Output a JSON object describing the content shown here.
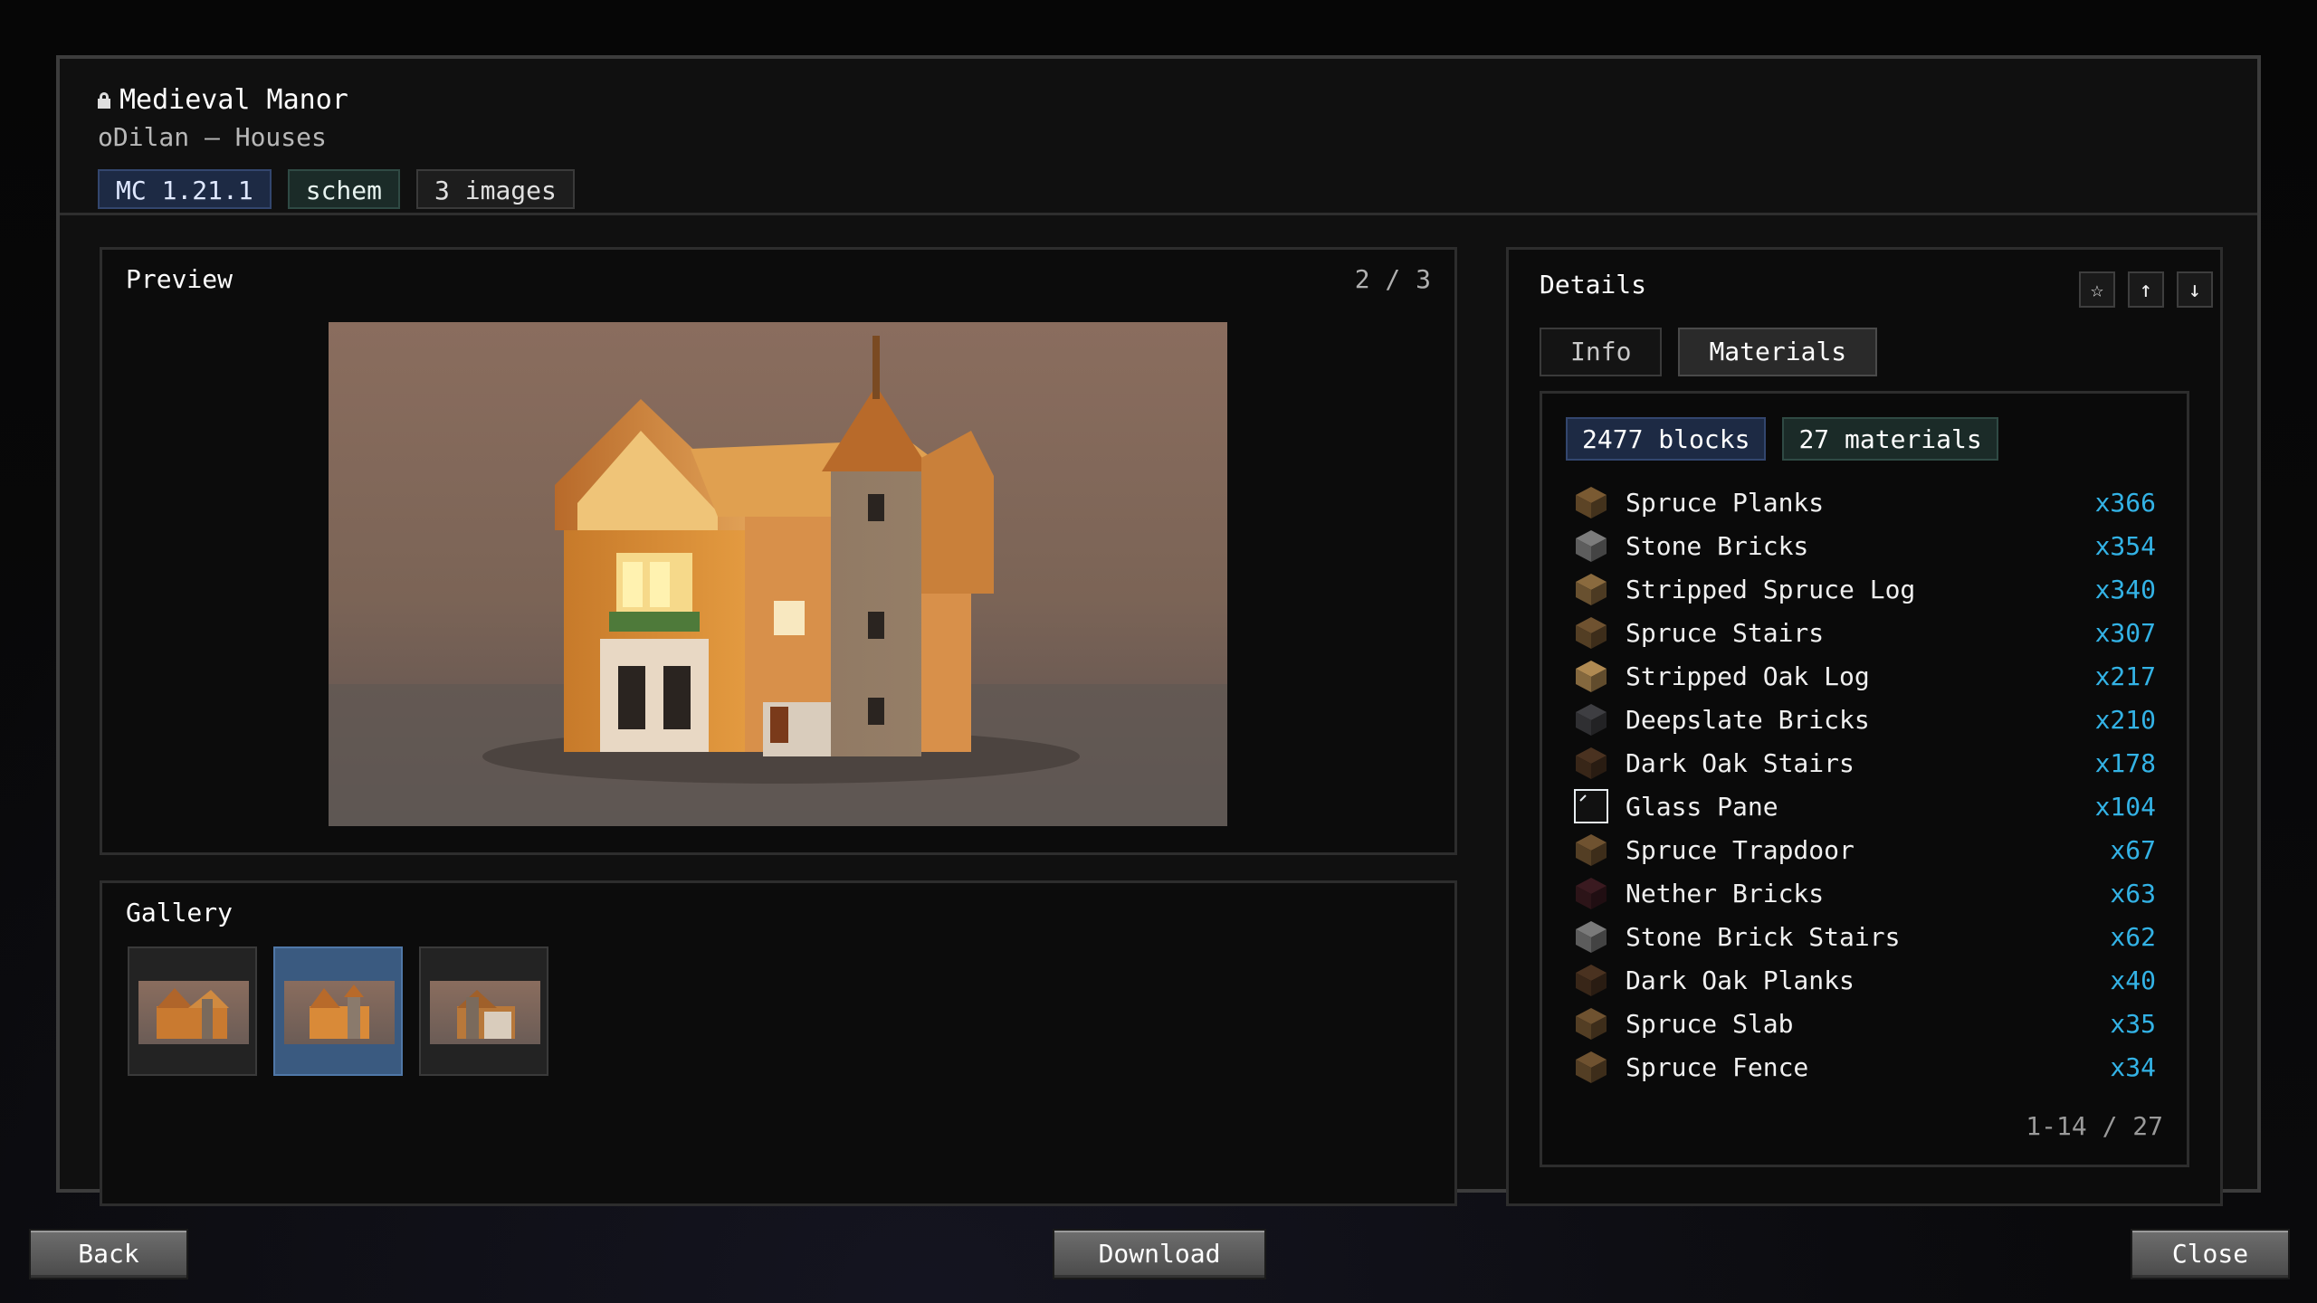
{
  "header": {
    "title": "Medieval Manor",
    "subtitle": "oDilan  –  Houses",
    "tags": [
      "MC 1.21.1",
      "schem",
      "3 images"
    ]
  },
  "preview": {
    "title": "Preview",
    "counter": "2 / 3"
  },
  "gallery": {
    "title": "Gallery",
    "selected_index": 1,
    "thumb_count": 3
  },
  "details": {
    "title": "Details",
    "icons": [
      "star-icon",
      "upload-icon",
      "download-icon"
    ],
    "tabs": [
      "Info",
      "Materials"
    ],
    "active_tab": "Materials",
    "stats": {
      "blocks": "2477 blocks",
      "materials": "27 materials"
    },
    "materials": [
      {
        "name": "Spruce Planks",
        "count": "x366",
        "icon": "spruce-planks-icon",
        "color": "#7a5a32"
      },
      {
        "name": "Stone Bricks",
        "count": "x354",
        "icon": "stone-bricks-icon",
        "color": "#7c7c7c"
      },
      {
        "name": "Stripped Spruce Log",
        "count": "x340",
        "icon": "stripped-spruce-log-icon",
        "color": "#8a6a3e"
      },
      {
        "name": "Spruce Stairs",
        "count": "x307",
        "icon": "spruce-stairs-icon",
        "color": "#6f5230"
      },
      {
        "name": "Stripped Oak Log",
        "count": "x217",
        "icon": "stripped-oak-log-icon",
        "color": "#b08a52"
      },
      {
        "name": "Deepslate Bricks",
        "count": "x210",
        "icon": "deepslate-bricks-icon",
        "color": "#3e3e42"
      },
      {
        "name": "Dark Oak Stairs",
        "count": "x178",
        "icon": "dark-oak-stairs-icon",
        "color": "#4a3220"
      },
      {
        "name": "Glass Pane",
        "count": "x104",
        "icon": "glass-pane-icon",
        "color": "#d8e8f0"
      },
      {
        "name": "Spruce Trapdoor",
        "count": "x67",
        "icon": "spruce-trapdoor-icon",
        "color": "#6f5230"
      },
      {
        "name": "Nether Bricks",
        "count": "x63",
        "icon": "nether-bricks-icon",
        "color": "#3a1a20"
      },
      {
        "name": "Stone Brick Stairs",
        "count": "x62",
        "icon": "stone-brick-stairs-icon",
        "color": "#7a7a7a"
      },
      {
        "name": "Dark Oak Planks",
        "count": "x40",
        "icon": "dark-oak-planks-icon",
        "color": "#4a3220"
      },
      {
        "name": "Spruce Slab",
        "count": "x35",
        "icon": "spruce-slab-icon",
        "color": "#6f5230"
      },
      {
        "name": "Spruce Fence",
        "count": "x34",
        "icon": "spruce-fence-icon",
        "color": "#6f5230"
      }
    ],
    "pager": "1-14 / 27"
  },
  "buttons": {
    "back": "Back",
    "download": "Download",
    "close": "Close"
  }
}
